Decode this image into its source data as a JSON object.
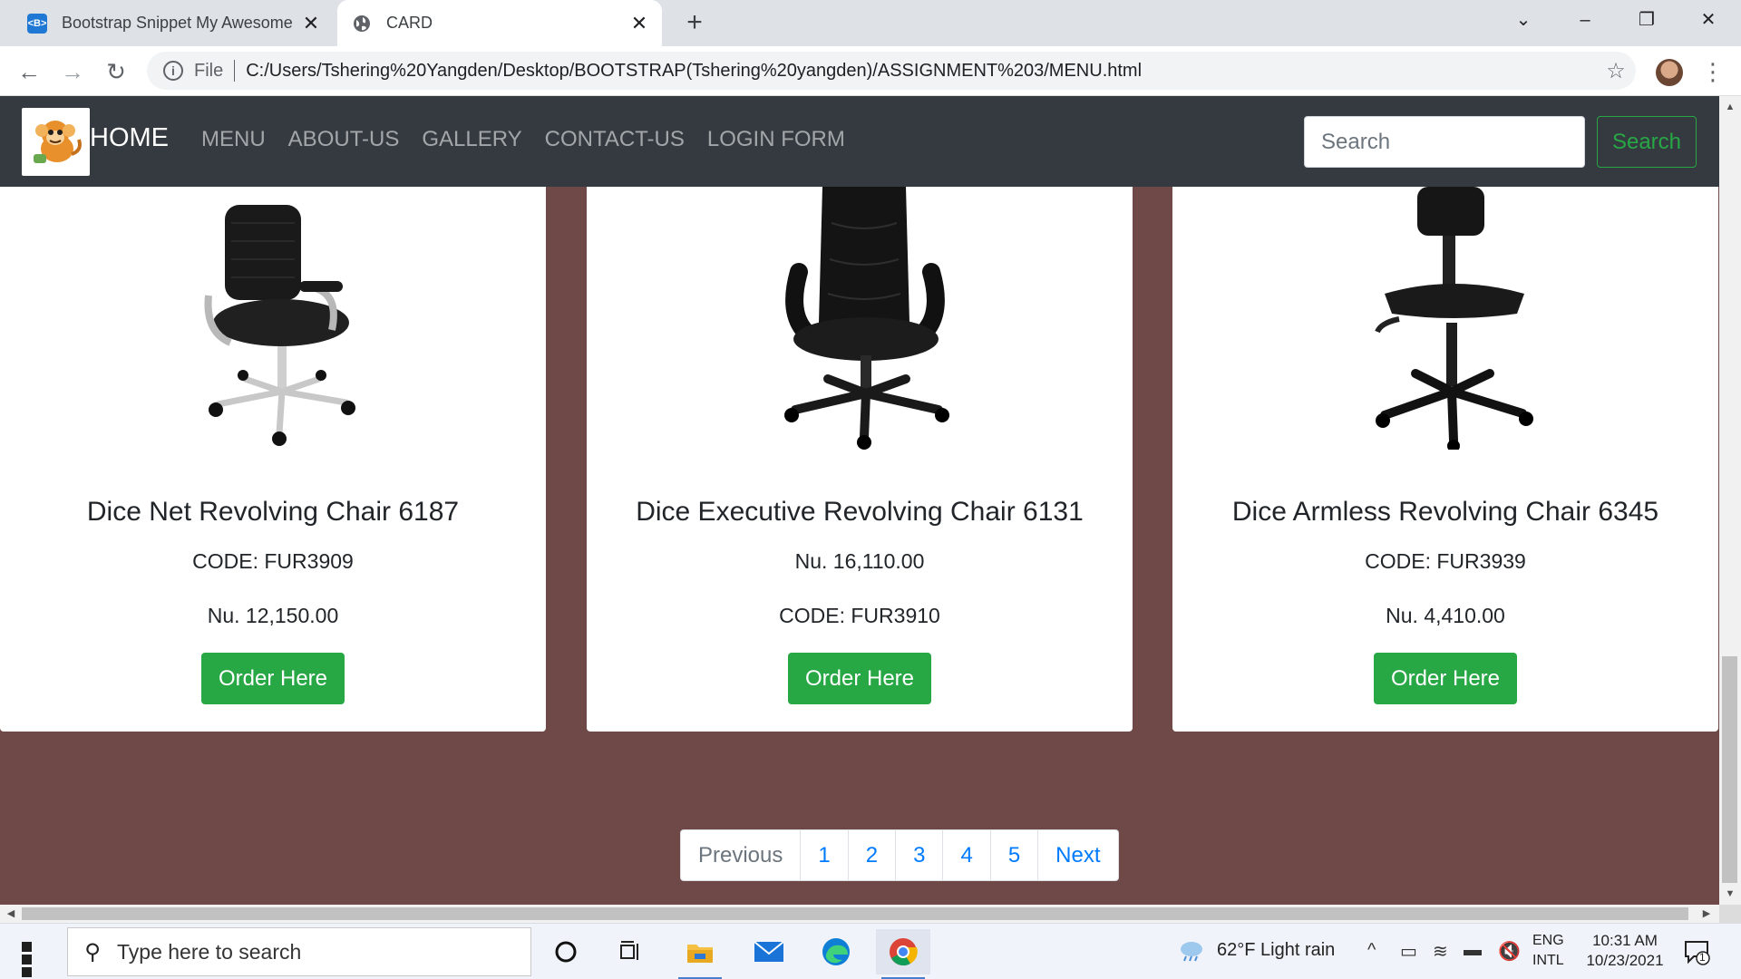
{
  "browser": {
    "tabs": [
      {
        "title": "Bootstrap Snippet My Awesome L",
        "favicon": "bootstrap-favicon-icon",
        "favicon_text": "<B>"
      },
      {
        "title": "CARD",
        "favicon": "globe-icon"
      }
    ],
    "address": {
      "scheme_label": "File",
      "url": "C:/Users/Tshering%20Yangden/Desktop/BOOTSTRAP(Tshering%20yangden)/ASSIGNMENT%203/MENU.html"
    }
  },
  "navbar": {
    "brand": "HOME",
    "links": [
      "MENU",
      "ABOUT-US",
      "GALLERY",
      "CONTACT-US",
      "LOGIN FORM"
    ],
    "search_placeholder": "Search",
    "search_button": "Search"
  },
  "products": [
    {
      "title": "Dice Net Revolving Chair 6187",
      "line1": "CODE: FUR3909",
      "line2": "Nu. 12,150.00",
      "button": "Order Here"
    },
    {
      "title": "Dice Executive Revolving Chair 6131",
      "line1": "Nu. 16,110.00",
      "line2": "CODE: FUR3910",
      "button": "Order Here"
    },
    {
      "title": "Dice Armless Revolving Chair 6345",
      "line1": "CODE: FUR3939",
      "line2": "Nu. 4,410.00",
      "button": "Order Here"
    }
  ],
  "pagination": [
    "Previous",
    "1",
    "2",
    "3",
    "4",
    "5",
    "Next"
  ],
  "colors": {
    "page_bg": "#6f4848",
    "navbar_bg": "#343a40",
    "success": "#28a745",
    "link": "#007bff"
  },
  "taskbar": {
    "search_placeholder": "Type here to search",
    "apps": [
      "cortana-icon",
      "task-view-icon",
      "file-explorer-icon",
      "mail-icon",
      "edge-icon",
      "chrome-icon"
    ],
    "weather": "62°F  Light rain",
    "lang_top": "ENG",
    "lang_bottom": "INTL",
    "time": "10:31 AM",
    "date": "10/23/2021",
    "notification_count": "1"
  }
}
